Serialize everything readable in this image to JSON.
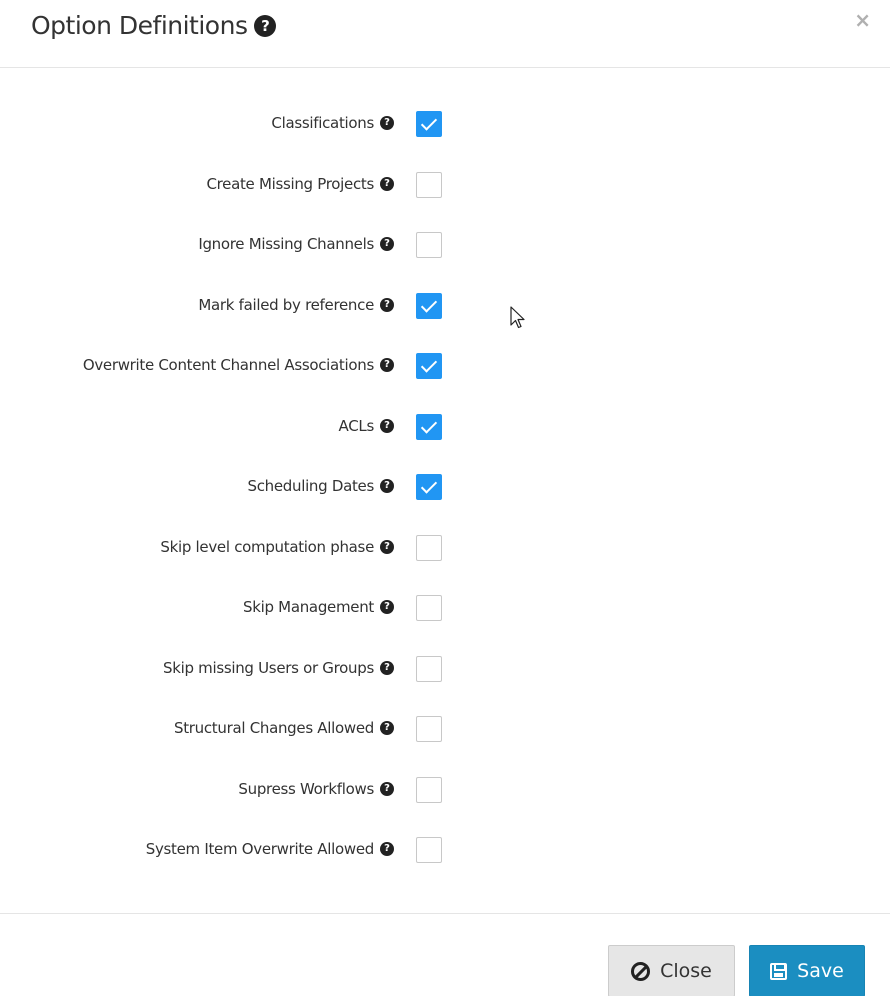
{
  "dialog": {
    "title": "Option Definitions",
    "close_symbol": "×"
  },
  "icons": {
    "help": "question-circle-icon",
    "close": "close-icon",
    "cancel": "ban-icon",
    "save": "floppy-disk-icon"
  },
  "options": [
    {
      "label": "Classifications",
      "checked": true
    },
    {
      "label": "Create Missing Projects",
      "checked": false
    },
    {
      "label": "Ignore Missing Channels",
      "checked": false
    },
    {
      "label": "Mark failed by reference",
      "checked": true
    },
    {
      "label": "Overwrite Content Channel Associations",
      "checked": true
    },
    {
      "label": "ACLs",
      "checked": true
    },
    {
      "label": "Scheduling Dates",
      "checked": true
    },
    {
      "label": "Skip level computation phase",
      "checked": false
    },
    {
      "label": "Skip Management",
      "checked": false
    },
    {
      "label": "Skip missing Users or Groups",
      "checked": false
    },
    {
      "label": "Structural Changes Allowed",
      "checked": false
    },
    {
      "label": "Supress Workflows",
      "checked": false
    },
    {
      "label": "System Item Overwrite Allowed",
      "checked": false
    }
  ],
  "footer": {
    "close_label": "Close",
    "save_label": "Save"
  },
  "colors": {
    "accent": "#2196f3",
    "save_button": "#1b8ec1",
    "close_button": "#e6e6e6"
  }
}
